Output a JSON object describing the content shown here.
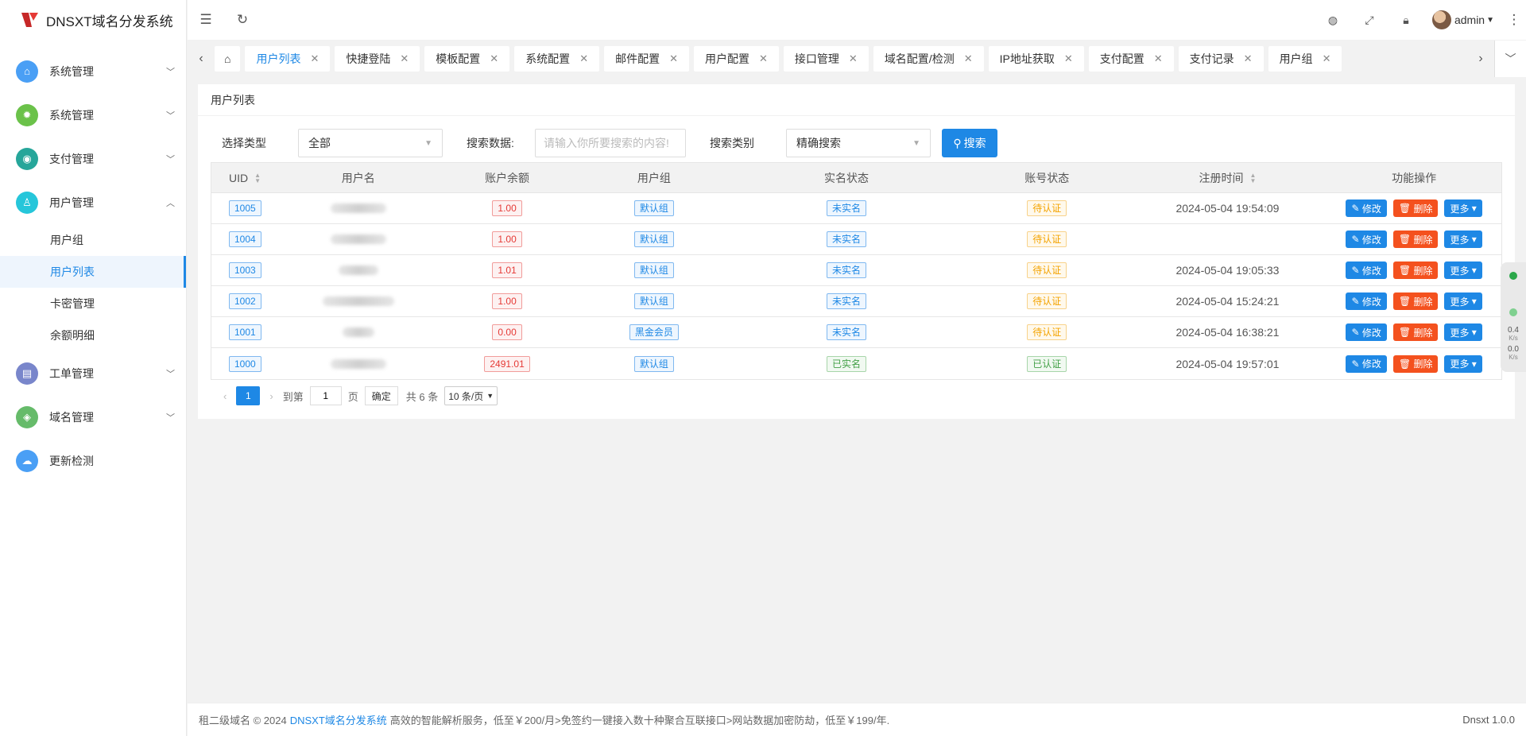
{
  "app": {
    "title": "DNSXT域名分发系统"
  },
  "sidebar": {
    "items": [
      {
        "label": "系统管理",
        "icon": "home-icon",
        "color": "#4a9ff5"
      },
      {
        "label": "系统管理",
        "icon": "settings-icon",
        "color": "#6bc24a"
      },
      {
        "label": "支付管理",
        "icon": "payment-icon",
        "color": "#26a69a"
      },
      {
        "label": "用户管理",
        "icon": "user-icon",
        "color": "#26c6da"
      },
      {
        "label": "工单管理",
        "icon": "ticket-icon",
        "color": "#7986cb"
      },
      {
        "label": "域名管理",
        "icon": "domain-icon",
        "color": "#66bb6a"
      },
      {
        "label": "更新检测",
        "icon": "cloud-update-icon",
        "color": "#4a9ff5"
      }
    ],
    "user_sub": [
      "用户组",
      "用户列表",
      "卡密管理",
      "余额明细"
    ]
  },
  "header": {
    "user": "admin"
  },
  "tabs": [
    {
      "label": "用户列表",
      "active": true
    },
    {
      "label": "快捷登陆"
    },
    {
      "label": "模板配置"
    },
    {
      "label": "系统配置"
    },
    {
      "label": "邮件配置"
    },
    {
      "label": "用户配置"
    },
    {
      "label": "接口管理"
    },
    {
      "label": "域名配置/检测"
    },
    {
      "label": "IP地址获取"
    },
    {
      "label": "支付配置"
    },
    {
      "label": "支付记录"
    },
    {
      "label": "用户组"
    }
  ],
  "page": {
    "title": "用户列表",
    "filters": {
      "type_label": "选择类型",
      "type_value": "全部",
      "data_label": "搜索数据:",
      "data_placeholder": "请输入你所要搜索的内容!",
      "category_label": "搜索类别",
      "category_value": "精确搜索",
      "search_button": "搜索"
    }
  },
  "table": {
    "columns": [
      "UID",
      "用户名",
      "账户余额",
      "用户组",
      "实名状态",
      "账号状态",
      "注册时间",
      "功能操作"
    ],
    "rows": [
      {
        "uid": "1005",
        "balance": "1.00",
        "group": "默认组",
        "realname": "未实名",
        "status": "待认证",
        "time": "2024-05-04 19:54:09"
      },
      {
        "uid": "1004",
        "balance": "1.00",
        "group": "默认组",
        "realname": "未实名",
        "status": "待认证",
        "time": ""
      },
      {
        "uid": "1003",
        "balance": "1.01",
        "group": "默认组",
        "realname": "未实名",
        "status": "待认证",
        "time": "2024-05-04 19:05:33"
      },
      {
        "uid": "1002",
        "balance": "1.00",
        "group": "默认组",
        "realname": "未实名",
        "status": "待认证",
        "time": "2024-05-04 15:24:21"
      },
      {
        "uid": "1001",
        "balance": "0.00",
        "group": "黑金会员",
        "realname": "未实名",
        "status": "待认证",
        "time": "2024-05-04 16:38:21"
      },
      {
        "uid": "1000",
        "balance": "2491.01",
        "group": "默认组",
        "realname": "已实名",
        "status": "已认证",
        "time": "2024-05-04 19:57:01"
      }
    ],
    "actions": {
      "edit": "修改",
      "delete": "删除",
      "more": "更多"
    }
  },
  "pager": {
    "current": "1",
    "goto_label": "到第",
    "goto_value": "1",
    "page_unit": "页",
    "confirm": "确定",
    "total": "共 6 条",
    "size": "10 条/页"
  },
  "footer": {
    "prefix": "租二级域名 © 2024",
    "link": "DNSXT域名分发系统",
    "suffix": "高效的智能解析服务，低至￥200/月>免签约一键接入数十种聚合互联接口>网站数据加密防劫，低至￥199/年.",
    "version": "Dnsxt 1.0.0"
  },
  "widget": {
    "up": "0.4",
    "up_unit": "K/s",
    "down": "0.0",
    "down_unit": "K/s"
  }
}
